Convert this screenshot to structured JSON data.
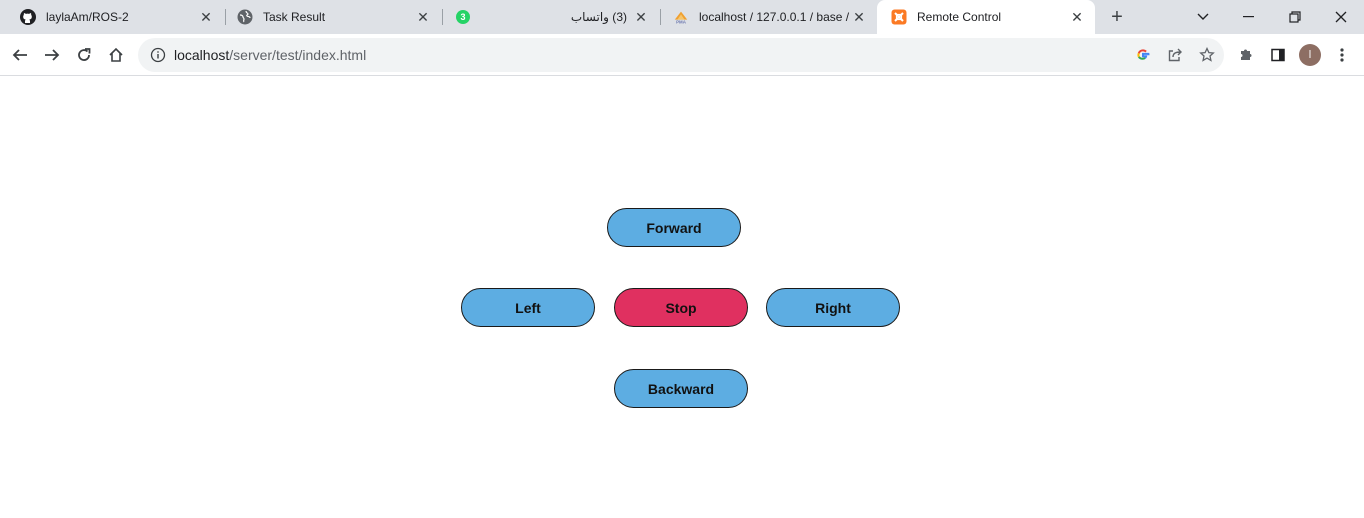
{
  "browser": {
    "tabs": [
      {
        "title": "laylaAm/ROS-2",
        "icon": "github-icon"
      },
      {
        "title": "Task Result",
        "icon": "globe-icon"
      },
      {
        "title": "(3) واتساب",
        "icon": "whatsapp-icon",
        "badge": "3"
      },
      {
        "title": "localhost / 127.0.0.1 / base /",
        "icon": "phpmyadmin-icon",
        "icon_text": "PMA"
      },
      {
        "title": "Remote Control",
        "icon": "xampp-icon",
        "active": true
      }
    ],
    "close_glyph": "✕",
    "new_tab_glyph": "+",
    "url_host": "localhost",
    "url_path": "/server/test/index.html",
    "profile_initial": "l"
  },
  "controls": {
    "forward": "Forward",
    "left": "Left",
    "stop": "Stop",
    "right": "Right",
    "backward": "Backward"
  },
  "colors": {
    "move_button": "#5dade2",
    "stop_button": "#e03060"
  }
}
